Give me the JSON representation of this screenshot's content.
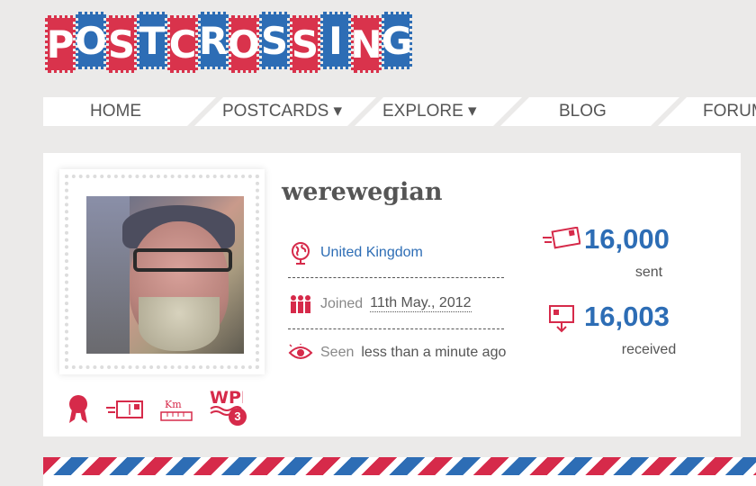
{
  "logo": {
    "letters": [
      "P",
      "O",
      "S",
      "T",
      "C",
      "R",
      "O",
      "S",
      "S",
      "I",
      "N",
      "G"
    ],
    "colors": {
      "red": "#d9334c",
      "blue": "#2d6db5"
    }
  },
  "nav": {
    "home": "HOME",
    "postcards": "POSTCARDS ▾",
    "explore": "EXPLORE ▾",
    "blog": "BLOG",
    "forum": "FORUM"
  },
  "profile": {
    "username": "werewegian",
    "country": "United Kingdom",
    "joined_label": "Joined",
    "joined_date": "11th May., 2012",
    "seen_label": "Seen",
    "seen_value": "less than a minute ago",
    "sent_count": "16,000",
    "sent_label": "sent",
    "received_count": "16,003",
    "received_label": "received",
    "wpd_count": "3"
  },
  "icons": {
    "country": "globe-icon",
    "joined": "people-icon",
    "seen": "eye-icon",
    "sent": "postcard-sent-icon",
    "received": "postcard-received-icon",
    "badges": [
      "ribbon-icon",
      "postcard-icon",
      "distance-ruler-icon",
      "wpd-icon"
    ]
  }
}
